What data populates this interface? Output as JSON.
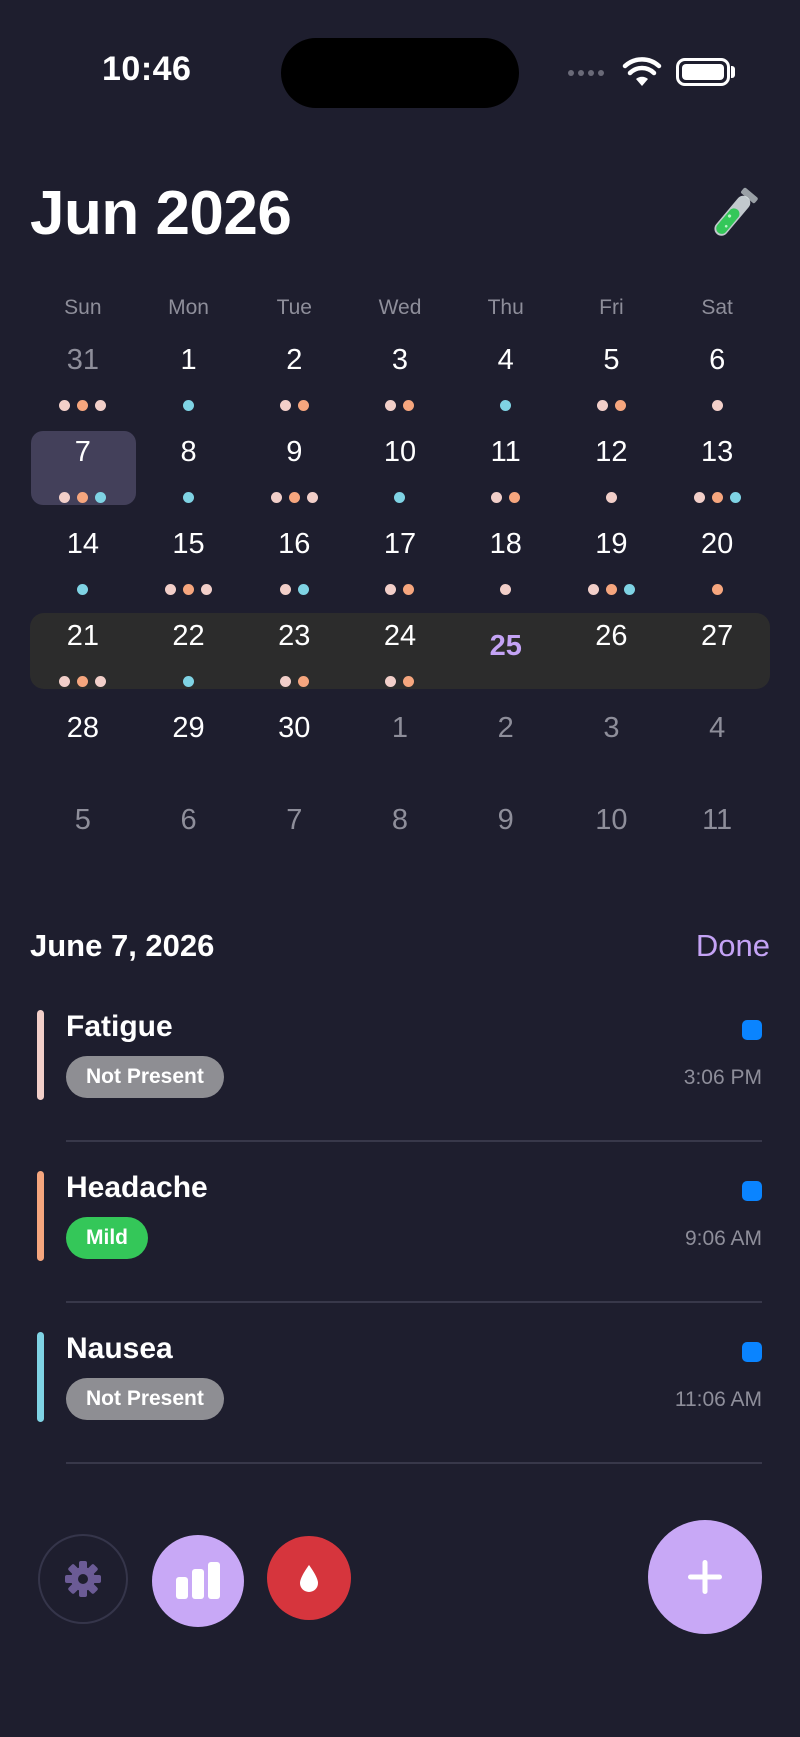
{
  "status": {
    "time": "10:46"
  },
  "header": {
    "title": "Jun 2026"
  },
  "calendar": {
    "weekdays": [
      "Sun",
      "Mon",
      "Tue",
      "Wed",
      "Thu",
      "Fri",
      "Sat"
    ],
    "weeks": [
      [
        {
          "d": "31",
          "other": true,
          "dots": [
            "pink",
            "orange",
            "pink"
          ]
        },
        {
          "d": "1",
          "dots": [
            "cyan"
          ]
        },
        {
          "d": "2",
          "dots": [
            "pink",
            "orange"
          ]
        },
        {
          "d": "3",
          "dots": [
            "pink",
            "orange"
          ]
        },
        {
          "d": "4",
          "dots": [
            "cyan"
          ]
        },
        {
          "d": "5",
          "dots": [
            "pink",
            "orange"
          ]
        },
        {
          "d": "6",
          "dots": [
            "pink"
          ]
        }
      ],
      [
        {
          "d": "7",
          "selected": true,
          "dots": [
            "pink",
            "orange",
            "cyan"
          ]
        },
        {
          "d": "8",
          "dots": [
            "cyan"
          ]
        },
        {
          "d": "9",
          "dots": [
            "pink",
            "orange",
            "pink"
          ]
        },
        {
          "d": "10",
          "dots": [
            "cyan"
          ]
        },
        {
          "d": "11",
          "dots": [
            "pink",
            "orange"
          ]
        },
        {
          "d": "12",
          "dots": [
            "pink"
          ]
        },
        {
          "d": "13",
          "dots": [
            "pink",
            "orange",
            "cyan"
          ]
        }
      ],
      [
        {
          "d": "14",
          "dots": [
            "cyan"
          ]
        },
        {
          "d": "15",
          "dots": [
            "pink",
            "orange",
            "pink"
          ]
        },
        {
          "d": "16",
          "dots": [
            "pink",
            "cyan"
          ]
        },
        {
          "d": "17",
          "dots": [
            "pink",
            "orange"
          ]
        },
        {
          "d": "18",
          "dots": [
            "pink"
          ]
        },
        {
          "d": "19",
          "dots": [
            "pink",
            "orange",
            "cyan"
          ]
        },
        {
          "d": "20",
          "dots": [
            "orange"
          ]
        }
      ],
      [
        {
          "d": "21",
          "dots": [
            "pink",
            "orange",
            "pink"
          ]
        },
        {
          "d": "22",
          "dots": [
            "cyan"
          ]
        },
        {
          "d": "23",
          "dots": [
            "pink",
            "orange"
          ]
        },
        {
          "d": "24",
          "dots": [
            "pink",
            "orange"
          ]
        },
        {
          "d": "25",
          "today": true,
          "dots": []
        },
        {
          "d": "26",
          "dots": []
        },
        {
          "d": "27",
          "dots": []
        }
      ],
      [
        {
          "d": "28",
          "dots": []
        },
        {
          "d": "29",
          "dots": []
        },
        {
          "d": "30",
          "dots": []
        },
        {
          "d": "1",
          "other": true,
          "dots": []
        },
        {
          "d": "2",
          "other": true,
          "dots": []
        },
        {
          "d": "3",
          "other": true,
          "dots": []
        },
        {
          "d": "4",
          "other": true,
          "dots": []
        }
      ],
      [
        {
          "d": "5",
          "other": true,
          "dots": []
        },
        {
          "d": "6",
          "other": true,
          "dots": []
        },
        {
          "d": "7",
          "other": true,
          "dots": []
        },
        {
          "d": "8",
          "other": true,
          "dots": []
        },
        {
          "d": "9",
          "other": true,
          "dots": []
        },
        {
          "d": "10",
          "other": true,
          "dots": []
        },
        {
          "d": "11",
          "other": true,
          "dots": []
        }
      ]
    ],
    "dot_colors": {
      "pink": "#f2cfc9",
      "orange": "#f6a67e",
      "cyan": "#7fd3e4"
    }
  },
  "detail": {
    "date": "June 7, 2026",
    "done_label": "Done",
    "entries": [
      {
        "name": "Fatigue",
        "severity": "Not Present",
        "time": "3:06 PM",
        "bar_color": "#f2cfc9",
        "badge_color": "#8e8e93"
      },
      {
        "name": "Headache",
        "severity": "Mild",
        "time": "9:06 AM",
        "bar_color": "#f6a67e",
        "badge_color": "#34c759"
      },
      {
        "name": "Nausea",
        "severity": "Not Present",
        "time": "11:06 AM",
        "bar_color": "#7fd3e4",
        "badge_color": "#8e8e93"
      }
    ]
  },
  "toolbar": {
    "icons": [
      "gear-icon",
      "bar-chart-icon",
      "drop-icon",
      "plus-icon"
    ]
  }
}
